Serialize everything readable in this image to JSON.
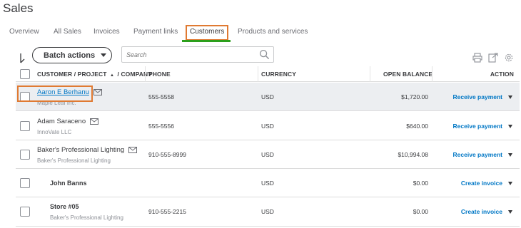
{
  "page": {
    "title": "Sales"
  },
  "tabs": [
    {
      "label": "Overview",
      "active": false
    },
    {
      "label": "All Sales",
      "active": false
    },
    {
      "label": "Invoices",
      "active": false
    },
    {
      "label": "Payment links",
      "active": false
    },
    {
      "label": "Customers",
      "active": true
    },
    {
      "label": "Products and services",
      "active": false
    }
  ],
  "toolbar": {
    "batch_actions_label": "Batch actions",
    "search_placeholder": "Search",
    "icons": [
      "sort-icon",
      "search-icon",
      "print-icon",
      "export-icon",
      "settings-icon"
    ]
  },
  "table": {
    "headers": {
      "customer": "CUSTOMER / PROJECT",
      "company": "/ COMPANY",
      "sort_indicator": "▲",
      "phone": "PHONE",
      "currency": "CURRENCY",
      "open_balance": "OPEN BALANCE",
      "action": "ACTION"
    },
    "rows": [
      {
        "name": "Aaron E Berhanu",
        "company": "Maple Leaf Inc.",
        "phone": "555-5558",
        "currency": "USD",
        "balance": "$1,720.00",
        "action": "Receive payment",
        "has_email": true,
        "highlighted": true,
        "indented": false
      },
      {
        "name": "Adam Saraceno",
        "company": "InnoVate LLC",
        "phone": "555-5556",
        "currency": "USD",
        "balance": "$640.00",
        "action": "Receive payment",
        "has_email": true,
        "highlighted": false,
        "indented": false
      },
      {
        "name": "Baker's Professional Lighting",
        "company": "Baker's Professional Lighting",
        "phone": "910-555-8999",
        "currency": "USD",
        "balance": "$10,994.08",
        "action": "Receive payment",
        "has_email": true,
        "highlighted": false,
        "indented": false
      },
      {
        "name": "John Banns",
        "company": "",
        "phone": "",
        "currency": "USD",
        "balance": "$0.00",
        "action": "Create invoice",
        "has_email": false,
        "highlighted": false,
        "indented": true
      },
      {
        "name": "Store #05",
        "company": "Baker's Professional Lighting",
        "phone": "910-555-2215",
        "currency": "USD",
        "balance": "$0.00",
        "action": "Create invoice",
        "has_email": false,
        "highlighted": false,
        "indented": true
      }
    ]
  },
  "colors": {
    "accent_green": "#2ca01c",
    "link_blue": "#0077c5",
    "highlight_orange": "#e07a32",
    "text": "#393a3d"
  }
}
